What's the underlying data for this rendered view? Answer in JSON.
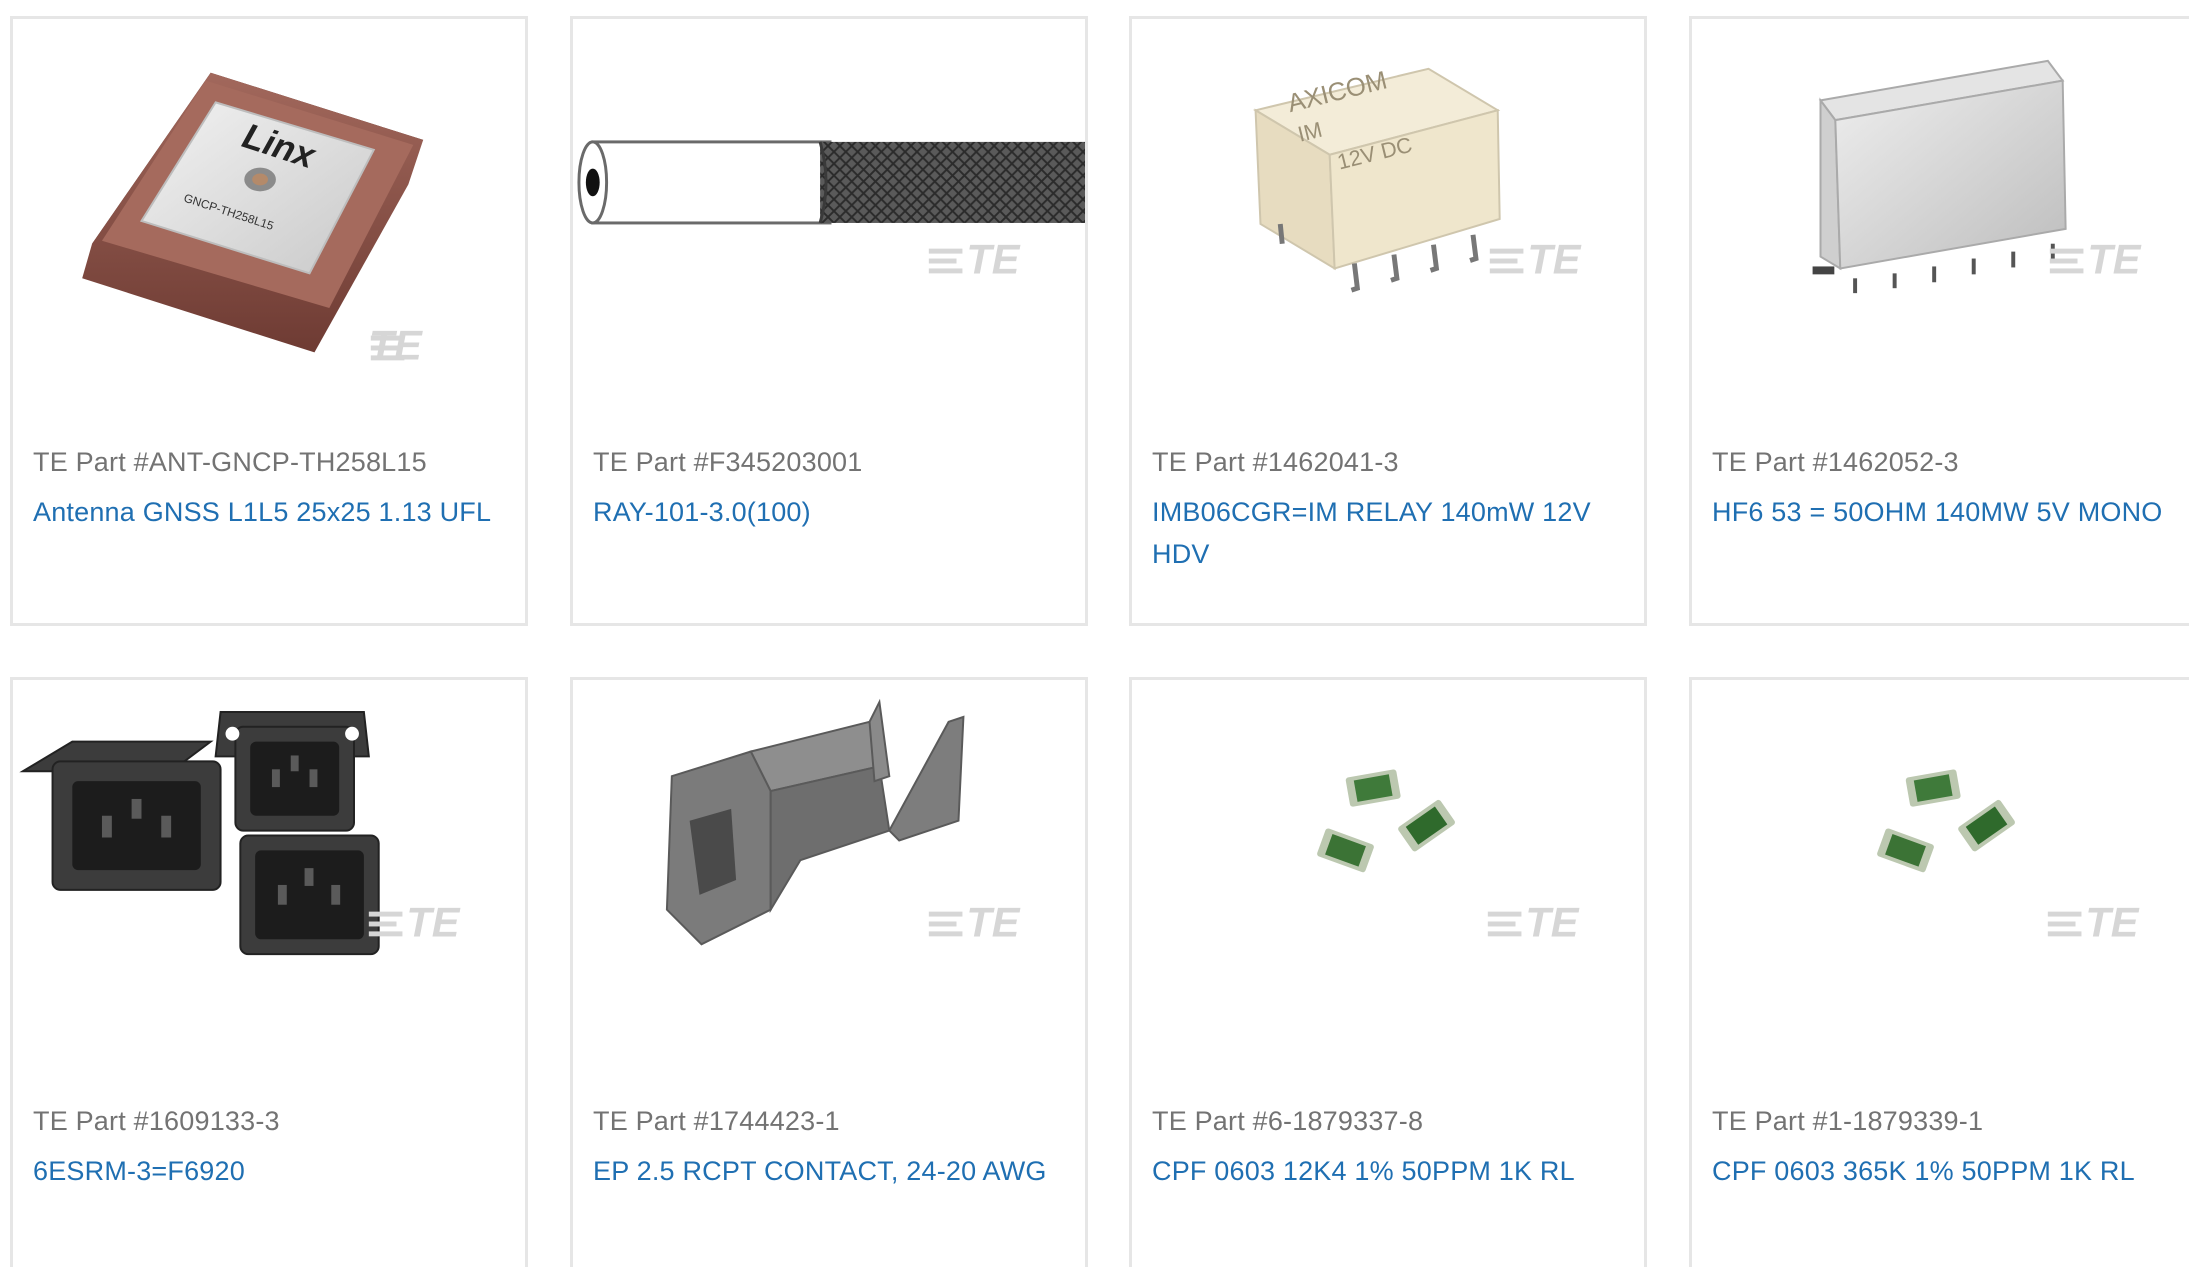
{
  "products": [
    {
      "part_number": "TE Part #ANT-GNCP-TH258L15",
      "description": "Antenna GNSS L1L5 25x25 1.13 UFL",
      "image_icon": "gnss-antenna-icon",
      "image_text": [
        "Linx",
        "GNCP-TH258L15"
      ]
    },
    {
      "part_number": "TE Part #F345203001",
      "description": "RAY-101-3.0(100)",
      "image_icon": "braided-cable-icon",
      "image_text": []
    },
    {
      "part_number": "TE Part #1462041-3",
      "description": "IMB06CGR=IM RELAY 140mW 12V HDV",
      "image_icon": "signal-relay-icon",
      "image_text": [
        "AXICOM",
        "IM",
        "12V DC"
      ]
    },
    {
      "part_number": "TE Part #1462052-3",
      "description": "HF6 53 = 50OHM 140MW 5V MONO",
      "image_icon": "rf-relay-icon",
      "image_text": []
    },
    {
      "part_number": "TE Part #1609133-3",
      "description": "6ESRM-3=F6920",
      "image_icon": "power-inlet-icon",
      "image_text": []
    },
    {
      "part_number": "TE Part #1744423-1",
      "description": "EP 2.5 RCPT CONTACT, 24-20 AWG",
      "image_icon": "receptacle-contact-icon",
      "image_text": []
    },
    {
      "part_number": "TE Part #6-1879337-8",
      "description": "CPF 0603 12K4 1% 50PPM 1K RL",
      "image_icon": "chip-resistor-icon",
      "image_text": []
    },
    {
      "part_number": "TE Part #1-1879339-1",
      "description": "CPF 0603 365K 1% 50PPM 1K RL",
      "image_icon": "chip-resistor-icon",
      "image_text": []
    }
  ],
  "watermark": "TE",
  "colors": {
    "link": "#1f6fb2",
    "part_number": "#737373",
    "card_border": "#e6e6e6",
    "watermark": "#d6d6d6"
  }
}
